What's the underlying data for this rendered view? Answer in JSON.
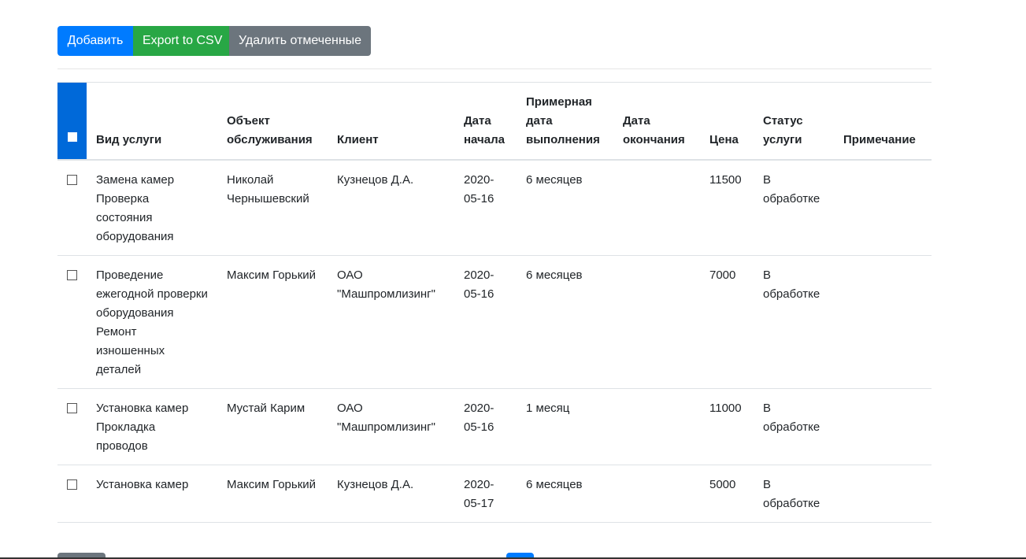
{
  "toolbar": {
    "add_label": "Добавить",
    "export_label": "Export to CSV",
    "delete_label": "Удалить отмеченные"
  },
  "table": {
    "headers": {
      "service": "Вид услуги",
      "object": "Объект обслуживания",
      "client": "Клиент",
      "start": "Дата начала",
      "estimated": "Примерная дата выполнения",
      "end": "Дата окончания",
      "price": "Цена",
      "status": "Статус услуги",
      "note": "Примечание"
    },
    "rows": [
      {
        "services": [
          "Замена камер",
          "Проверка состояния оборудования"
        ],
        "object": "Николай Чернышевский",
        "client": "Кузнецов Д.А.",
        "start": "2020-05-16",
        "estimated": "6 месяцев",
        "end": "",
        "price": "11500",
        "status": "В обработке",
        "note": ""
      },
      {
        "services": [
          "Проведение ежегодной проверки оборудования",
          "Ремонт изношенных деталей"
        ],
        "object": "Максим Горький",
        "client": "ОАО \"Машпромлизинг\"",
        "start": "2020-05-16",
        "estimated": "6 месяцев",
        "end": "",
        "price": "7000",
        "status": "В обработке",
        "note": ""
      },
      {
        "services": [
          "Установка камер",
          "Прокладка проводов"
        ],
        "object": "Мустай Карим",
        "client": "ОАО \"Машпромлизинг\"",
        "start": "2020-05-16",
        "estimated": "1 месяц",
        "end": "",
        "price": "11000",
        "status": "В обработке",
        "note": ""
      },
      {
        "services": [
          "Установка камер"
        ],
        "object": "Максим Горький",
        "client": "Кузнецов Д.А.",
        "start": "2020-05-17",
        "estimated": "6 месяцев",
        "end": "",
        "price": "5000",
        "status": "В обработке",
        "note": ""
      }
    ]
  },
  "colors": {
    "primary": "#007bff",
    "success": "#28a745",
    "secondary": "#6c757d",
    "header_check_bg": "#0069d9"
  }
}
